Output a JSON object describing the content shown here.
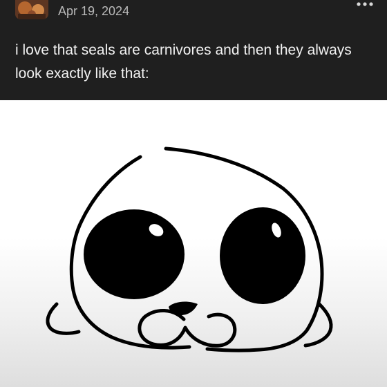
{
  "post": {
    "username": "",
    "follow_label": "",
    "date": "Apr 19, 2024",
    "text": "i love that seals are carnivores and then they always look exactly like that:"
  },
  "icons": {
    "avatar": "avatar-image",
    "more": "more-options-icon"
  },
  "image": {
    "subject": "seal-drawing"
  },
  "colors": {
    "background": "#1f1f1f",
    "text": "#f2f2f2",
    "date": "#b9b9b9",
    "follow": "#4f9ee0"
  }
}
